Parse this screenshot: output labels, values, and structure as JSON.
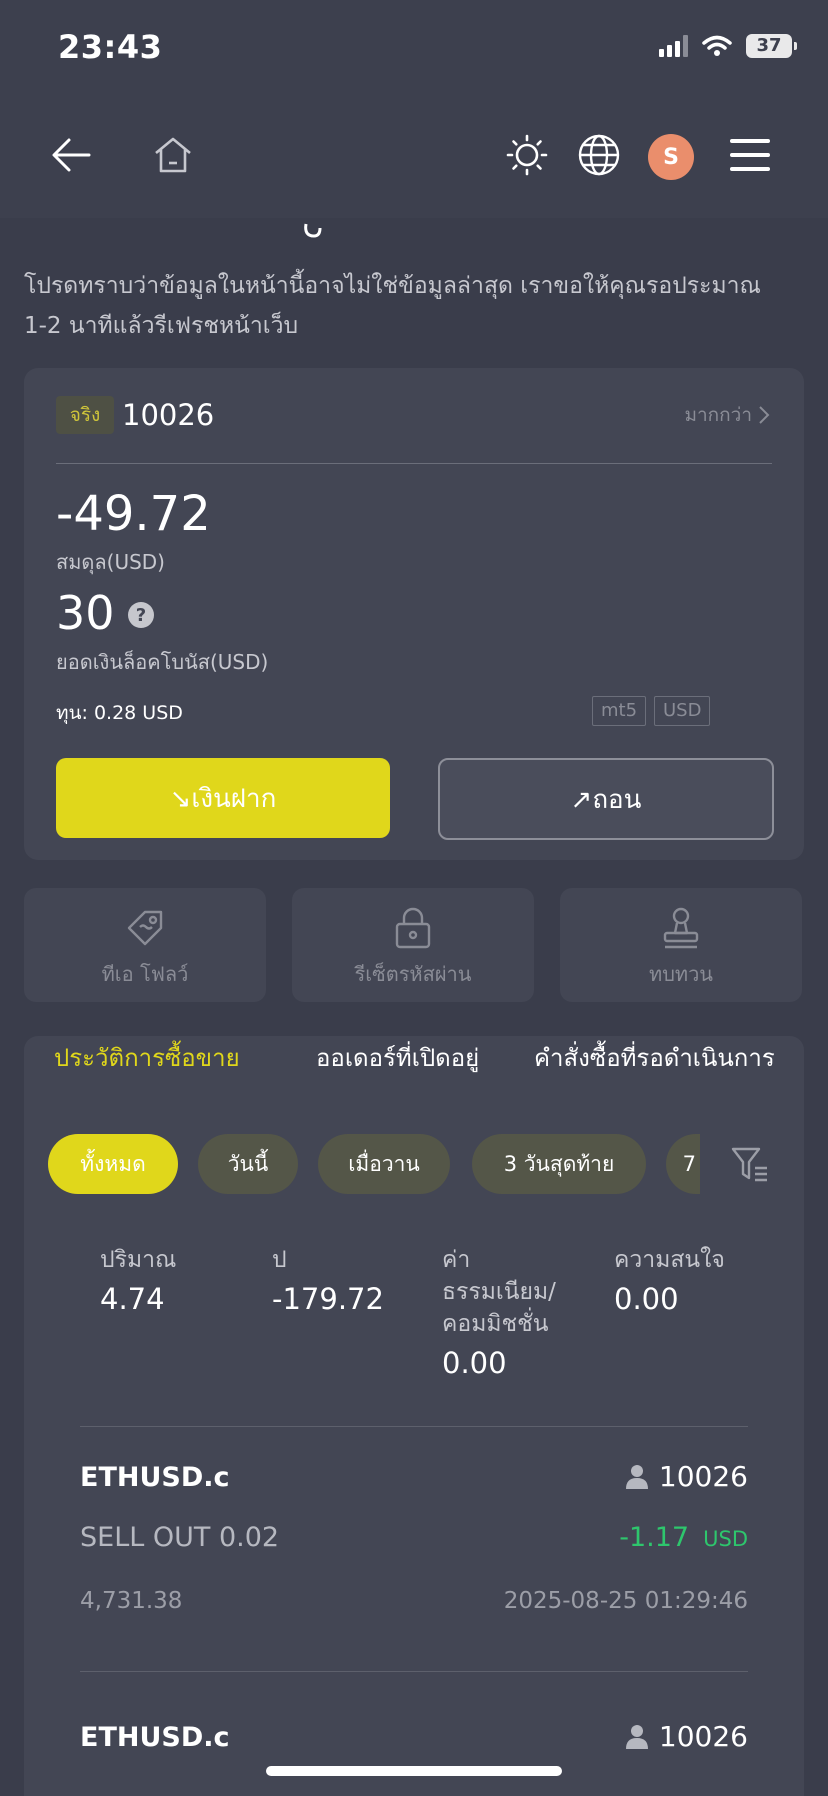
{
  "status_bar": {
    "time": "23:43",
    "battery": "37"
  },
  "nav": {
    "avatar_letter": "S"
  },
  "notice": "โปรดทราบว่าข้อมูลในหน้านี้อาจไม่ใช่ข้อมูลล่าสุด เราขอให้คุณรอประมาณ 1-2 นาทีแล้วรีเฟรชหน้าเว็บ",
  "account": {
    "tag": "จริง",
    "number": "10026",
    "more": "มากกว่า",
    "balance": "-49.72",
    "balance_label": "สมดุล(USD)",
    "bonus": "30",
    "bonus_label": "ยอดเงินล็อคโบนัส(USD)",
    "capital": "ทุน: 0.28 USD",
    "badges": [
      "mt5",
      "USD"
    ],
    "deposit": "↘เงินฝาก",
    "withdraw": "↗ถอน"
  },
  "tiles": [
    {
      "label": "ทีเอ โฟลว์",
      "icon": "ticket-icon"
    },
    {
      "label": "รีเซ็ตรหัสผ่าน",
      "icon": "lock-icon"
    },
    {
      "label": "ทบทวน",
      "icon": "stamp-icon"
    }
  ],
  "history": {
    "tabs": [
      "ประวัติการซื้อขาย",
      "ออเดอร์ที่เปิดอยู่",
      "คำสั่งซื้อที่รอดำเนินการ"
    ],
    "active_tab": 0,
    "filters": [
      "ทั้งหมด",
      "วันนี้",
      "เมื่อวาน",
      "3 วันสุดท้าย",
      "7"
    ],
    "active_filter": 0,
    "stats": [
      {
        "label": "ปริมาณ",
        "value": "4.74"
      },
      {
        "label": "ป",
        "value": "-179.72"
      },
      {
        "label": "ค่าธรรมเนียม/คอมมิชชั่น",
        "value": "0.00"
      },
      {
        "label": "ความสนใจ",
        "value": "0.00"
      }
    ],
    "trades": [
      {
        "symbol": "ETHUSD.c",
        "account": "10026",
        "side": "SELL OUT 0.02",
        "pnl": "-1.17",
        "currency": "USD",
        "price": "4,731.38",
        "time": "2025-08-25 01:29:46"
      },
      {
        "symbol": "ETHUSD.c",
        "account": "10026"
      }
    ]
  },
  "colors": {
    "accent": "#e0d71b",
    "background": "#3a3d4b",
    "card": "#434654",
    "profit_text": "#2ec66d"
  }
}
